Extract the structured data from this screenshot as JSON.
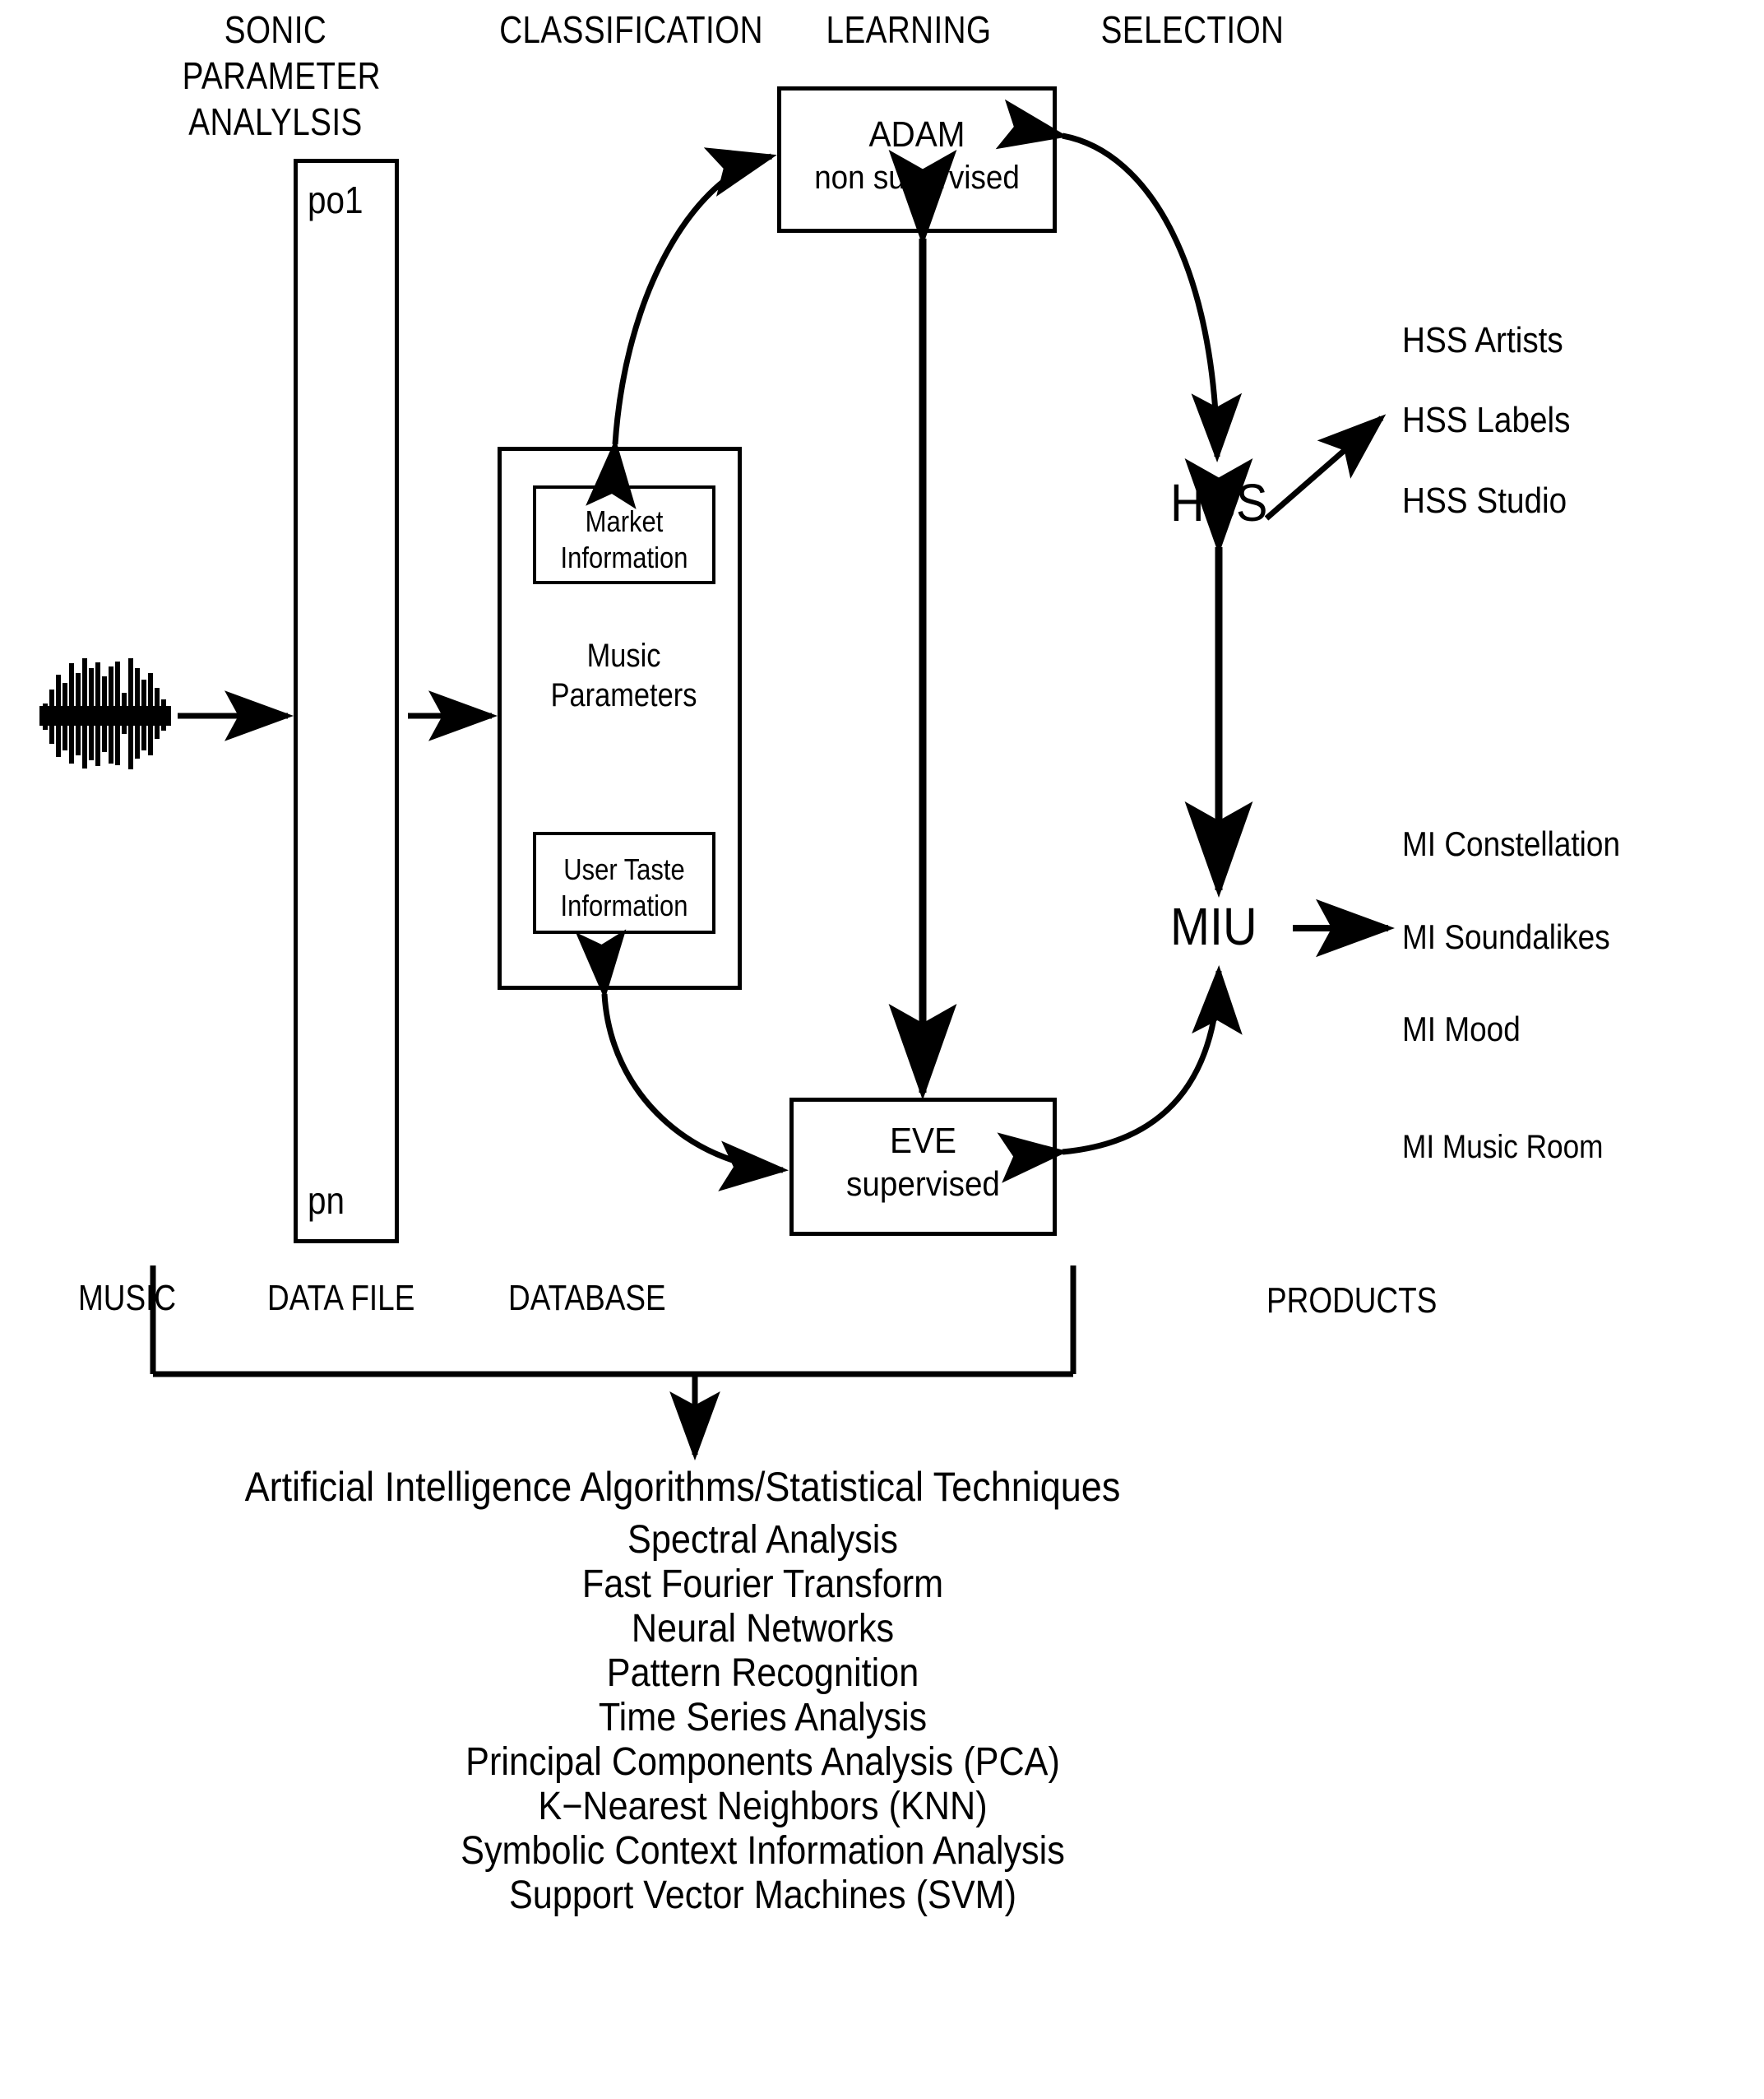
{
  "diagram": {
    "column_headers": [
      {
        "lines": [
          "SONIC",
          "PARAMETER",
          "ANALYLSIS"
        ]
      },
      {
        "lines": [
          "CLASSIFICATION"
        ]
      },
      {
        "lines": [
          "LEARNING"
        ]
      },
      {
        "lines": [
          "SELECTION"
        ]
      }
    ],
    "data_file": {
      "top_label": "po1",
      "bottom_label": "pn"
    },
    "database": {
      "market_info": "Market\nInformation",
      "market_info_line1": "Market",
      "market_info_line2": "Information",
      "music_parameters_line1": "Music",
      "music_parameters_line2": "Parameters",
      "user_taste_line1": "User Taste",
      "user_taste_line2": "Information"
    },
    "adam": {
      "line1": "ADAM",
      "line2": "non  supervised"
    },
    "eve": {
      "line1": "EVE",
      "line2": "supervised"
    },
    "selection_nodes": {
      "hss": "HSS",
      "miu": "MIU"
    },
    "products": {
      "hss": [
        "HSS  Artists",
        "HSS  Labels",
        "HSS  Studio"
      ],
      "mi": [
        "MI Constellation",
        "MI  Soundalikes",
        "MI  Mood",
        "MI Music Room"
      ]
    },
    "band_labels": {
      "music": "MUSIC",
      "data_file": "DATA FILE",
      "database": "DATABASE",
      "products": "PRODUCTS"
    },
    "techniques": {
      "heading": "Artificial  Intelligence  Algorithms/Statistical  Techniques",
      "items": [
        "Spectral  Analysis",
        "Fast  Fourier  Transform",
        "Neural  Networks",
        "Pattern  Recognition",
        "Time  Series  Analysis",
        "Principal  Components   Analysis  (PCA)",
        "K−Nearest  Neighbors  (KNN)",
        "Symbolic  Context  Information  Analysis",
        "Support  Vector  Machines  (SVM)"
      ]
    },
    "icons": {
      "waveform": "audio-waveform"
    },
    "colors": {
      "ink": "#000000",
      "background": "#ffffff"
    }
  }
}
